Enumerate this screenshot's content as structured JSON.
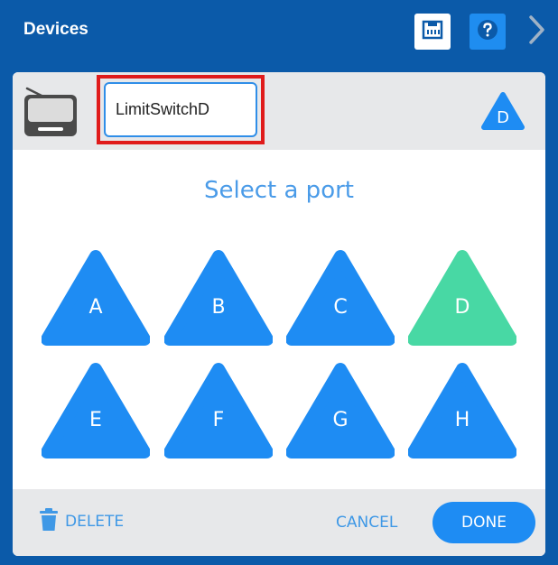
{
  "titlebar": {
    "title": "Devices",
    "icons": [
      "port-icon",
      "help-icon",
      "chevron-right-icon"
    ]
  },
  "device": {
    "name_value": "LimitSwitchD",
    "selected_port": "D",
    "icon": "limit-switch-device-icon"
  },
  "prompt": "Select a port",
  "ports": [
    {
      "label": "A",
      "state": "available"
    },
    {
      "label": "B",
      "state": "available"
    },
    {
      "label": "C",
      "state": "available"
    },
    {
      "label": "D",
      "state": "selected"
    },
    {
      "label": "E",
      "state": "available"
    },
    {
      "label": "F",
      "state": "available"
    },
    {
      "label": "G",
      "state": "available"
    },
    {
      "label": "H",
      "state": "available"
    }
  ],
  "footer": {
    "delete_label": "DELETE",
    "cancel_label": "CANCEL",
    "done_label": "DONE"
  },
  "colors": {
    "titlebar_bg": "#0b5aa9",
    "port_available": "#1e8cf3",
    "port_selected": "#48d8a4",
    "accent_text": "#3f98e6",
    "highlight_border": "#e01b1b"
  }
}
